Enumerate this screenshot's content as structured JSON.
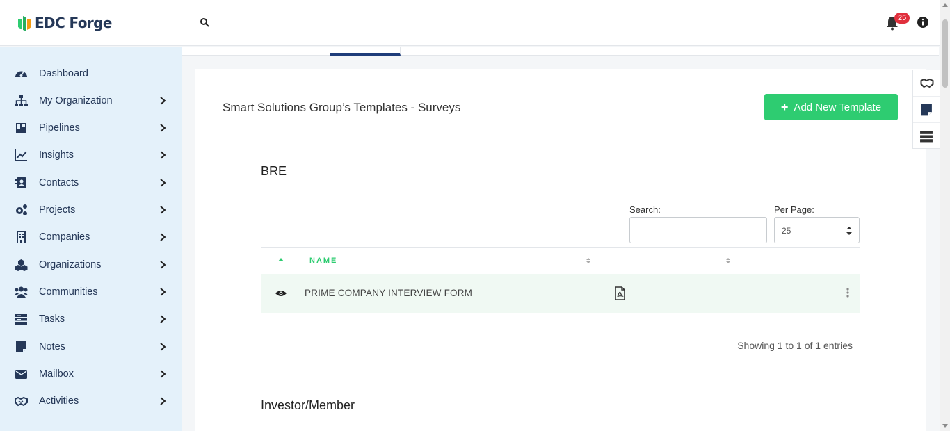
{
  "app": {
    "name": "EDC Forge"
  },
  "header": {
    "notification_count": "25"
  },
  "sidebar": {
    "items": [
      {
        "label": "Dashboard",
        "icon": "dashboard-icon",
        "has_children": false
      },
      {
        "label": "My Organization",
        "icon": "sitemap-icon",
        "has_children": true
      },
      {
        "label": "Pipelines",
        "icon": "kanban-icon",
        "has_children": true
      },
      {
        "label": "Insights",
        "icon": "line-chart-icon",
        "has_children": true
      },
      {
        "label": "Contacts",
        "icon": "contact-card-icon",
        "has_children": true
      },
      {
        "label": "Projects",
        "icon": "gears-icon",
        "has_children": true
      },
      {
        "label": "Companies",
        "icon": "building-icon",
        "has_children": true
      },
      {
        "label": "Organizations",
        "icon": "cubes-icon",
        "has_children": true
      },
      {
        "label": "Communities",
        "icon": "users-icon",
        "has_children": true
      },
      {
        "label": "Tasks",
        "icon": "tasks-icon",
        "has_children": true
      },
      {
        "label": "Notes",
        "icon": "note-icon",
        "has_children": true
      },
      {
        "label": "Mailbox",
        "icon": "envelope-icon",
        "has_children": true
      },
      {
        "label": "Activities",
        "icon": "handshake-icon",
        "has_children": true
      }
    ]
  },
  "main": {
    "title": "Smart Solutions Group’s Templates - Surveys",
    "add_button_label": "Add New Template",
    "sections": [
      {
        "title": "BRE",
        "search_label": "Search:",
        "search_value": "",
        "per_page_label": "Per Page:",
        "per_page_value": "25",
        "columns": [
          "NAME"
        ],
        "rows": [
          {
            "name": "PRIME COMPANY INTERVIEW FORM"
          }
        ],
        "showing": "Showing 1 to 1 of 1 entries"
      },
      {
        "title": "Investor/Member"
      }
    ]
  },
  "colors": {
    "accent_green": "#2ecc71",
    "navy": "#253858",
    "sidebar_bg": "#e4f1fa",
    "badge_red": "#e0303d"
  }
}
